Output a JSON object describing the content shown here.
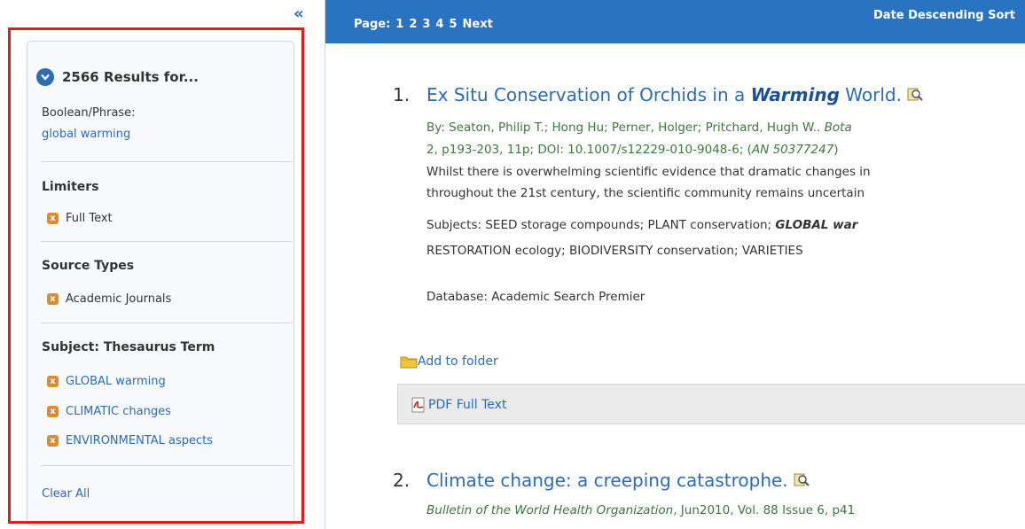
{
  "left": {
    "collapse_glyph": "«",
    "results_count": "2566 Results for...",
    "boolean_label": "Boolean/Phrase:",
    "query": "global warming",
    "limiters": {
      "heading": "Limiters",
      "items": [
        "Full Text"
      ]
    },
    "source_types": {
      "heading": "Source Types",
      "items": [
        "Academic Journals"
      ]
    },
    "subject": {
      "heading": "Subject: Thesaurus Term",
      "items": [
        "GLOBAL warming",
        "CLIMATIC changes",
        "ENVIRONMENTAL aspects"
      ]
    },
    "remove_glyph": "x",
    "clear_all": "Clear All"
  },
  "topbar": {
    "page_label": "Page:",
    "pages": [
      "1",
      "2",
      "3",
      "4",
      "5"
    ],
    "next": "Next",
    "sort": "Date Descending Sort"
  },
  "results": [
    {
      "num": "1.",
      "title_pre": "Ex Situ Conservation of Orchids in a ",
      "title_hl": "Warming",
      "title_post": " World.",
      "authors": "By: Seaton, Philip T.; Hong Hu; Perner, Holger; Pritchard, Hugh W.. ",
      "authors_src": "Bota",
      "citation_line": "2, p193-203, 11p; DOI: 10.1007/s12229-010-9048-6; (",
      "an": "AN 50377247",
      "citation_close": ")",
      "abstract1": "Whilst there is overwhelming scientific evidence that dramatic changes in",
      "abstract2": "throughout the 21st century, the scientific community remains uncertain",
      "subjects_pre": "Subjects: SEED storage compounds; PLANT conservation; ",
      "subjects_hl": "GLOBAL war",
      "subjects2": "RESTORATION ecology; BIODIVERSITY conservation; VARIETIES",
      "database": "Database: Academic Search Premier",
      "folder": "Add to folder",
      "pdf": "PDF Full Text"
    },
    {
      "num": "2.",
      "title": "Climate change: a creeping catastrophe.",
      "source_italic": "Bulletin of the World Health Organization",
      "source_rest": ", Jun2010, Vol. 88 Issue 6, p41"
    }
  ],
  "colors": {
    "topbar": "#2a73c1",
    "link": "#2b6cb8",
    "highlight": "#e21b1b",
    "remove": "#e08a2c",
    "meta_green": "#3a7a3a"
  }
}
